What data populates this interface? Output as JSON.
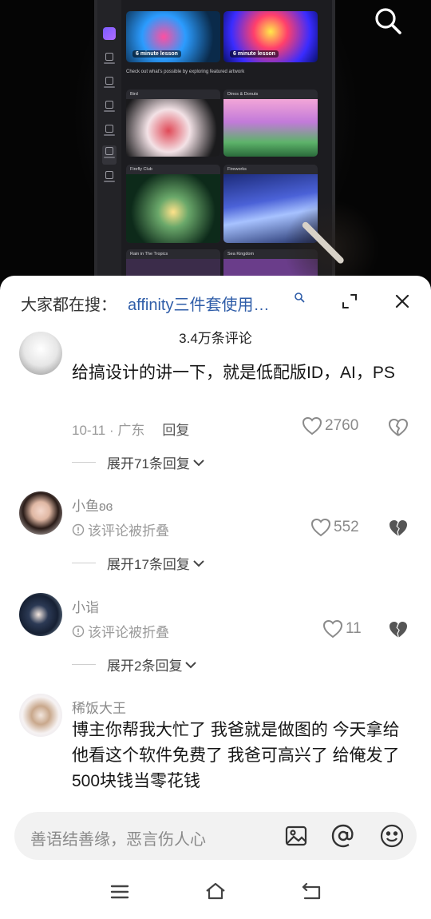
{
  "video": {
    "lesson_labels": [
      "6 minute lesson",
      "6 minute lesson"
    ],
    "featured_text": "Check out what's possible by exploring featured artwork",
    "tiles": [
      "Bird",
      "Dinos & Donuts",
      "Firefly Club",
      "Fireworks",
      "Rain in The Tropics",
      "Sea Kingdom"
    ]
  },
  "sheet": {
    "search_prefix": "大家都在搜：",
    "search_query": "affinity三件套使用…",
    "comment_count": "3.4万条评论"
  },
  "comments": [
    {
      "username": "",
      "text": "给搞设计的讲一下，就是低配版ID，AI，PS",
      "date_location": "10-11 · 广东",
      "reply_label": "回复",
      "likes": "2760",
      "expand_label": "展开71条回复"
    },
    {
      "username": "小鱼ʚɞ",
      "folded_note": "该评论被折叠",
      "likes": "552",
      "expand_label": "展开17条回复"
    },
    {
      "username": "小诣",
      "folded_note": "该评论被折叠",
      "likes": "11",
      "expand_label": "展开2条回复"
    },
    {
      "username": "稀饭大王",
      "text": "博主你帮我大忙了 我爸就是做图的 今天拿给他看这个软件免费了 我爸可高兴了 给俺发了500块钱当零花钱"
    }
  ],
  "input": {
    "placeholder": "善语结善缘，恶言伤人心"
  },
  "icons": {
    "search": "search-icon",
    "expand": "expand-icon",
    "close": "close-icon",
    "like": "heart-icon",
    "dislike": "broken-heart-icon",
    "image": "image-icon",
    "mention": "at-icon",
    "emoji": "emoji-icon",
    "menu": "menu-icon",
    "home": "home-icon",
    "back": "back-icon"
  },
  "colors": {
    "query_blue": "#2f5da8",
    "sheet_bg": "#ffffff",
    "muted": "#9a9a9a"
  }
}
